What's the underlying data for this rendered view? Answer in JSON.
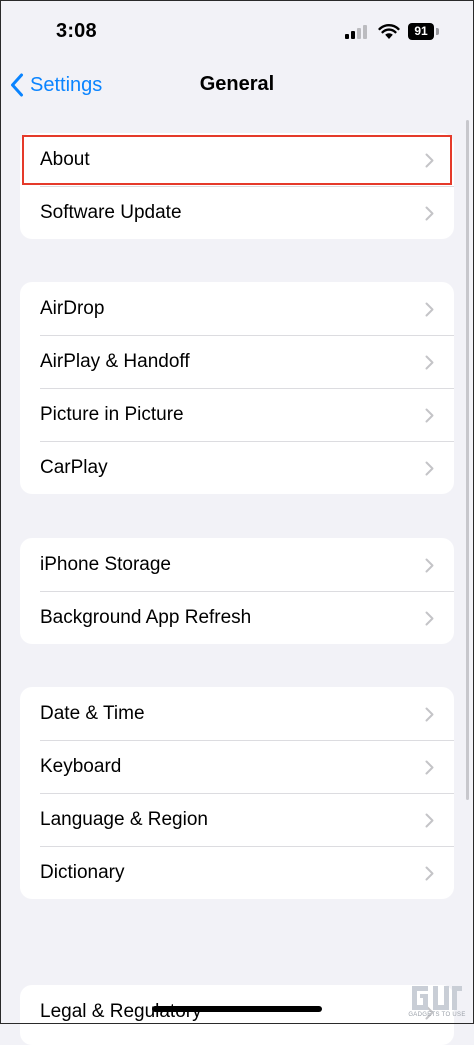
{
  "status_bar": {
    "time": "3:08",
    "battery_level": "91"
  },
  "nav": {
    "back_label": "Settings",
    "title": "General"
  },
  "groups": [
    {
      "items": [
        {
          "label": "About"
        },
        {
          "label": "Software Update"
        }
      ]
    },
    {
      "items": [
        {
          "label": "AirDrop"
        },
        {
          "label": "AirPlay & Handoff"
        },
        {
          "label": "Picture in Picture"
        },
        {
          "label": "CarPlay"
        }
      ]
    },
    {
      "items": [
        {
          "label": "iPhone Storage"
        },
        {
          "label": "Background App Refresh"
        }
      ]
    },
    {
      "items": [
        {
          "label": "Date & Time"
        },
        {
          "label": "Keyboard"
        },
        {
          "label": "Language & Region"
        },
        {
          "label": "Dictionary"
        }
      ]
    },
    {
      "items": [
        {
          "label": "Legal & Regulatory"
        }
      ]
    }
  ],
  "watermark": {
    "caption": "GADGETS TO USE"
  },
  "colors": {
    "accent": "#0a84ff",
    "highlight_box": "#e53a2a",
    "background": "#f2f2f7"
  },
  "icons": [
    "cellular-signal-icon",
    "wifi-icon",
    "battery-icon",
    "chevron-left-icon",
    "chevron-right-icon",
    "watermark-logo-icon"
  ]
}
